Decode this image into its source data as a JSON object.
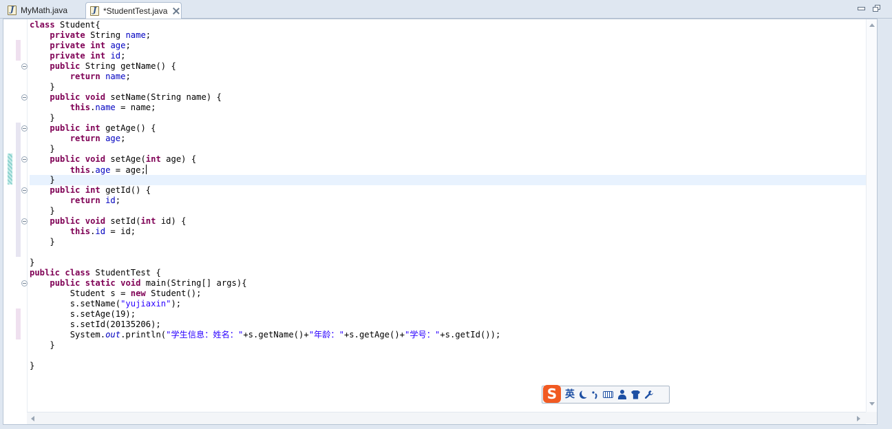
{
  "tabs": [
    {
      "label": "MyMath.java",
      "icon": "java-file-icon",
      "active": false
    },
    {
      "label": "*StudentTest.java",
      "icon": "java-file-icon",
      "active": true
    }
  ],
  "window_controls": {
    "minimize": "minimize-icon",
    "restore": "restore-icon"
  },
  "code_lines": [
    "class Student{",
    "    private String name;",
    "    private int age;",
    "    private int id;",
    "    public String getName() {",
    "        return name;",
    "    }",
    "    public void setName(String name) {",
    "        this.name = name;",
    "    }",
    "    public int getAge() {",
    "        return age;",
    "    }",
    "    public void setAge(int age) {",
    "        this.age = age;",
    "    }",
    "    public int getId() {",
    "        return id;",
    "    }",
    "    public void setId(int id) {",
    "        this.id = id;",
    "    }",
    "",
    "}",
    "public class StudentTest {",
    "    public static void main(String[] args){",
    "        Student s = new Student();",
    "        s.setName(\"yujiaxin\");",
    "        s.setAge(19);",
    "        s.setId(20135206);",
    "        System.out.println(\"学生信息：姓名：\"+s.getName()+\"年龄：\"+s.getAge()+\"学号：\"+s.getId());",
    "    }",
    "",
    "}"
  ],
  "current_line": 15,
  "ime_toolbar": {
    "logo": "S",
    "mode_label": "英",
    "icons": [
      "moon-icon",
      "punctuation-icon",
      "keyboard-icon",
      "user-icon",
      "skin-icon",
      "wrench-icon"
    ]
  },
  "colors": {
    "keyword": "#7f0055",
    "field": "#0000c0",
    "string": "#2a00ff",
    "current_line_bg": "#e8f2fe"
  }
}
